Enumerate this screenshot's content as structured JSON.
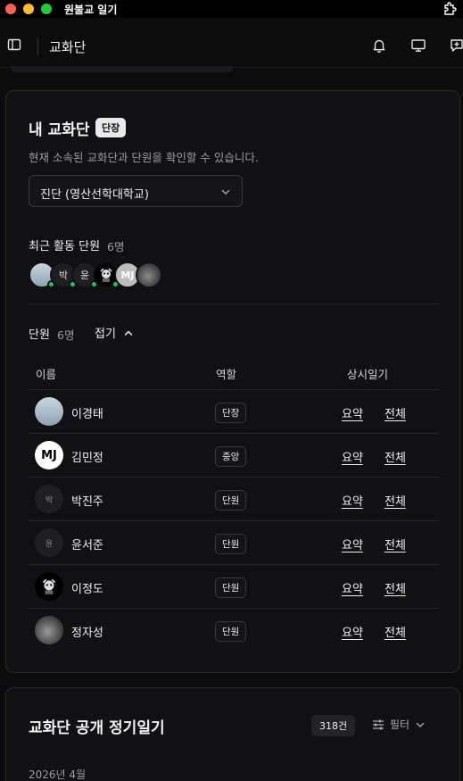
{
  "window": {
    "title": "원불교 일기"
  },
  "header": {
    "title": "교화단"
  },
  "group_card": {
    "title": "내 교화단",
    "role_badge": "단장",
    "subtitle": "현재 소속된 교화단과 단원을 확인할 수 있습니다.",
    "selected_group": "진단 (영산선학대학교)",
    "recent_label": "최근 활동 단원",
    "recent_count": "6명",
    "recent_avatars": [
      {
        "initial": "",
        "kind": "sky-photo",
        "online": true
      },
      {
        "initial": "박",
        "kind": "text",
        "online": true
      },
      {
        "initial": "윤",
        "kind": "text",
        "online": true
      },
      {
        "initial": "",
        "kind": "character",
        "online": true
      },
      {
        "initial": "MJ",
        "kind": "text",
        "online": false
      },
      {
        "initial": "",
        "kind": "photo",
        "online": false
      }
    ],
    "members_label": "단원",
    "members_count": "6명",
    "collapse_label": "접기",
    "columns": {
      "name": "이름",
      "role": "역할",
      "diary": "상시일기"
    },
    "members": [
      {
        "avatar": "",
        "avatar_kind": "sky-photo",
        "name": "이경태",
        "role": "단장",
        "summary": "요약",
        "full": "전체"
      },
      {
        "avatar": "MJ",
        "avatar_kind": "mj",
        "name": "김민정",
        "role": "중앙",
        "summary": "요약",
        "full": "전체"
      },
      {
        "avatar": "박",
        "avatar_kind": "text",
        "name": "박진주",
        "role": "단원",
        "summary": "요약",
        "full": "전체"
      },
      {
        "avatar": "윤",
        "avatar_kind": "text",
        "name": "윤서준",
        "role": "단원",
        "summary": "요약",
        "full": "전체"
      },
      {
        "avatar": "",
        "avatar_kind": "character",
        "name": "이정도",
        "role": "단원",
        "summary": "요약",
        "full": "전체"
      },
      {
        "avatar": "",
        "avatar_kind": "photo",
        "name": "정자성",
        "role": "단원",
        "summary": "요약",
        "full": "전체"
      }
    ]
  },
  "public_card": {
    "title": "교화단 공개 정기일기",
    "count": "318건",
    "filter_label": "필터",
    "date_heading": "2026년 4월"
  },
  "colors": {
    "background": "#0c0c0d",
    "card": "#111113",
    "online": "#22c55e"
  }
}
